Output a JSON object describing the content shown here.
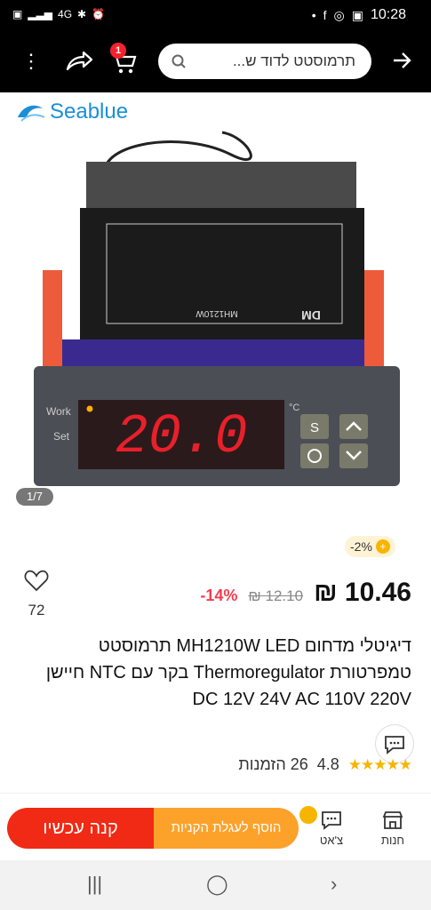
{
  "status_bar": {
    "time": "10:28",
    "network": "4G"
  },
  "app_bar": {
    "cart_badge": "1",
    "search_value": "תרמוסטט לדוד ש..."
  },
  "gallery": {
    "brand": "Seablue",
    "counter": "1/7",
    "device_display": "20.0",
    "labels": {
      "work": "Work",
      "set": "Set",
      "unit": "°C",
      "s_key": "S",
      "model": "MH1210W",
      "maker": "DM"
    }
  },
  "product": {
    "coupon": "2%-",
    "wishlist_count": "72",
    "price": "10.46 ₪",
    "old_price": "12.10 ₪",
    "discount": "14%-",
    "title": "דיגיטלי מדחום MH1210W LED תרמוסטט טמפרטורת Thermoregulator בקר עם NTC חיישן DC 12V 24V AC 110V 220V",
    "rating": "4.8",
    "orders": "26 הזמנות"
  },
  "bottom": {
    "buy_now": "קנה עכשיו",
    "add_to_cart": "הוסף לעגלת הקניות",
    "chat_label": "צ'אט",
    "store_label": "חנות"
  },
  "colors": {
    "buy": "#f02a14",
    "add": "#fca22b",
    "price_discount": "#f23d4f",
    "star": "#f7b500"
  }
}
